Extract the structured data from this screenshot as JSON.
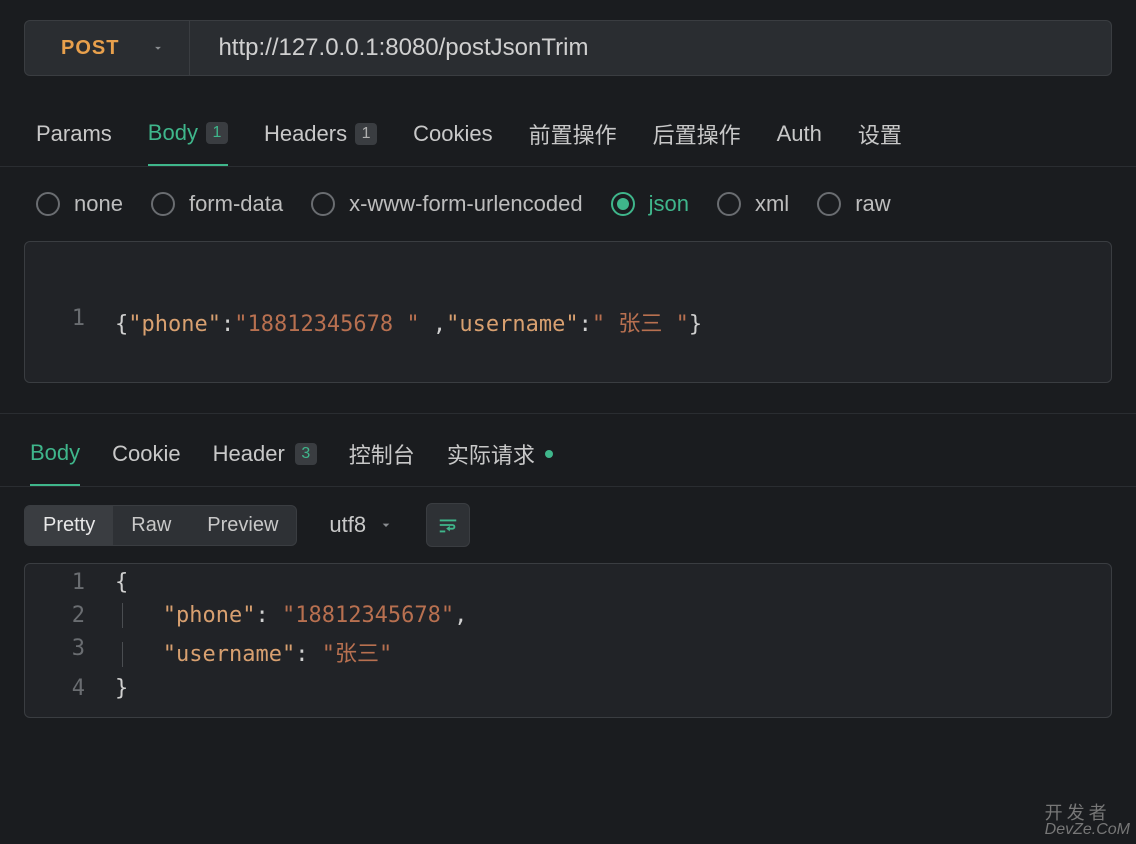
{
  "request": {
    "method": "POST",
    "url": "http://127.0.0.1:8080/postJsonTrim"
  },
  "tabs": {
    "params": "Params",
    "body": "Body",
    "body_badge": "1",
    "headers": "Headers",
    "headers_badge": "1",
    "cookies": "Cookies",
    "preop": "前置操作",
    "postop": "后置操作",
    "auth": "Auth",
    "settings": "设置"
  },
  "body_types": {
    "none": "none",
    "form_data": "form-data",
    "xwww": "x-www-form-urlencoded",
    "json": "json",
    "xml": "xml",
    "raw": "raw"
  },
  "request_body": {
    "line1_num": "1",
    "open": "{",
    "k1": "\"phone\"",
    "v1": "\"18812345678 \"",
    "sep": " ,",
    "k2": "\"username\"",
    "v2": "\" 张三 \"",
    "close": "}"
  },
  "response_tabs": {
    "body": "Body",
    "cookie": "Cookie",
    "header": "Header",
    "header_badge": "3",
    "console": "控制台",
    "actual": "实际请求"
  },
  "response_toolbar": {
    "pretty": "Pretty",
    "raw": "Raw",
    "preview": "Preview",
    "encoding": "utf8"
  },
  "response_body": {
    "l1n": "1",
    "l1": "{",
    "l2n": "2",
    "l2_key": "\"phone\"",
    "l2_val": "\"18812345678\"",
    "l2_comma": ",",
    "l3n": "3",
    "l3_key": "\"username\"",
    "l3_val": "\"张三\"",
    "l4n": "4",
    "l4": "}"
  },
  "watermark": {
    "l1": "开发者",
    "l2": "DevZe.CoM"
  }
}
